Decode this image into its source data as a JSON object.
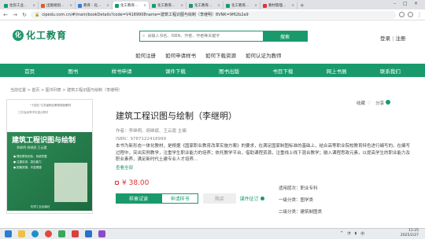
{
  "browser": {
    "tabs": [
      {
        "label": "住房工业..."
      },
      {
        "label": "出版规划..."
      },
      {
        "label": "教育 - 化..."
      },
      {
        "label": "化工教育..."
      },
      {
        "label": "化工教育..."
      },
      {
        "label": "化工教育..."
      },
      {
        "label": "化工教育..."
      },
      {
        "label": "教材管理..."
      }
    ],
    "url": "cipedu.com.cn/#/main/bookDetails?code=V4189908name=建筑工程识图与绘制（李继明）8VNK=9f62b2a9"
  },
  "header": {
    "logo_mark": "化",
    "logo_text": "化工教育",
    "search_placeholder": "请输入书名、ISBN、作者、作者等关键字",
    "search_button": "搜索",
    "login": "登录",
    "separator": "|",
    "register": "注册"
  },
  "quick_links": [
    "如何注册",
    "如何申请样书",
    "如何下载资源",
    "如何认证为教师"
  ],
  "nav": [
    "首页",
    "图书",
    "样书申请",
    "课件下载",
    "图书出版",
    "书目下载",
    "网上书展",
    "联系我们"
  ],
  "breadcrumb": "当前位置 > 首页 > 图书列表 > 建筑工程识图与绘制（李继明）",
  "cover": {
    "series": "\"十四五\"江苏省职业教育规划教材",
    "series2": "江苏省高等学校重点教材",
    "title": "建筑工程识图与绘制",
    "authors": "李继明  胡继斌  王云霞",
    "bullets": [
      "● 理论联系实际，系统完整",
      "● 注重实训，突出能力",
      "● 配套资源，丰富便捷"
    ],
    "publisher": "化学工业出版社"
  },
  "book": {
    "title": "建筑工程识图与绘制（李继明）",
    "authors": "作者：李继明、胡继斌、王云霞 主编",
    "isbn": "ISBN：9787122418999",
    "description": "本书为新形态一体化教材，是根据《国家职业教育改革实施方案》的要求，在满足国家制图标准的基础上，结合高等职业院校教育特色进行编写的。在编写过程中，突出实例教学，注重学生职业能力的培养；依托教学平台，借助课程资源，注重线上线下混合教学；融入课程思政元素，以提高学生的职业能力及职业素养，满足新时代土建专业人才培养...",
    "read_all": "查看全部",
    "price": "¥ 38.00",
    "favorite": "收藏",
    "share": "分享",
    "btn_read": "样章试读",
    "btn_apply": "申请样书",
    "btn_buy": "购买",
    "btn_eval": "课件征订",
    "categories": [
      "适用层次：职业专科",
      "一级分类：图学类",
      "二级分类：建筑制图类"
    ]
  },
  "taskbar": {
    "time": "11:25",
    "date": "2025/2/27",
    "lang": "中"
  }
}
